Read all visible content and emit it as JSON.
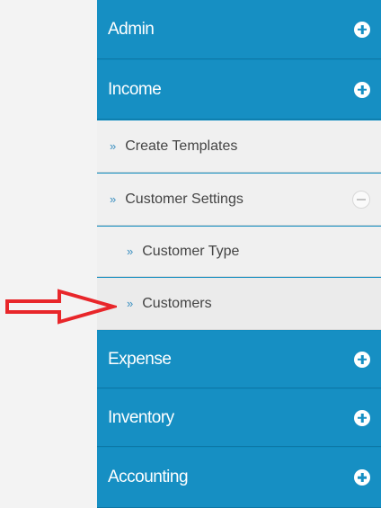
{
  "menu": {
    "items": [
      {
        "label": "Admin",
        "icon": "plus-circle-icon"
      },
      {
        "label": "Income",
        "icon": "plus-circle-icon"
      },
      {
        "label": "Expense",
        "icon": "plus-circle-icon"
      },
      {
        "label": "Inventory",
        "icon": "plus-circle-icon"
      },
      {
        "label": "Accounting",
        "icon": "plus-circle-icon"
      }
    ],
    "income_sub": {
      "create_templates": "Create Templates",
      "customer_settings": "Customer Settings",
      "customer_type": "Customer Type",
      "customers": "Customers"
    },
    "chevron": "»"
  },
  "annotation": {
    "color": "#e8262a",
    "icon": "right-arrow-annotation"
  },
  "colors": {
    "accent": "#168fc3",
    "submenu_bg": "#f0f0f0"
  }
}
